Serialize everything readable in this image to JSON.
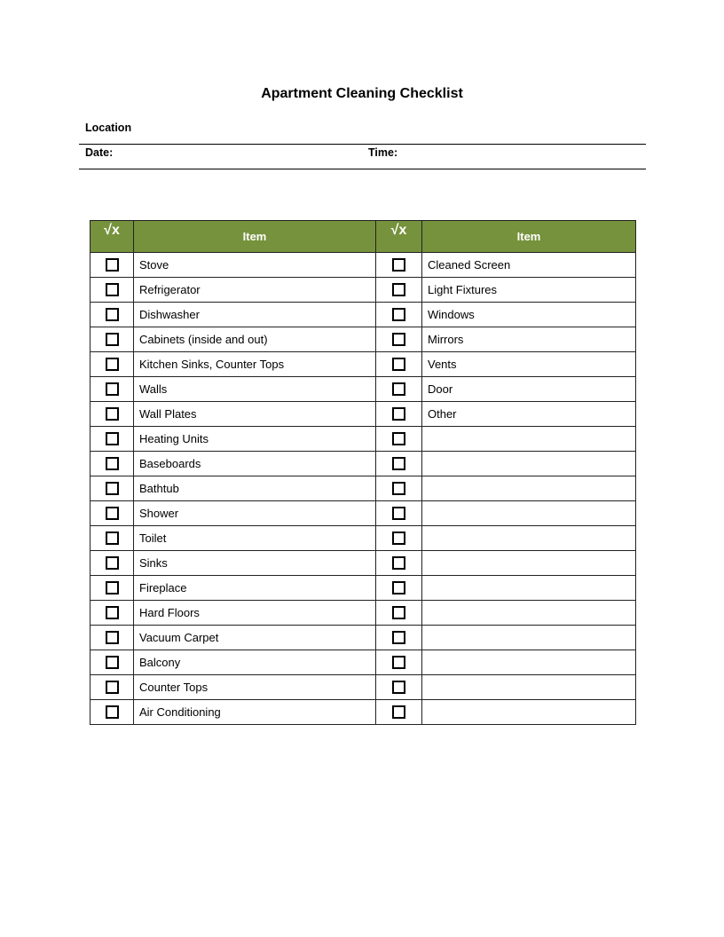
{
  "document": {
    "title": "Apartment Cleaning Checklist",
    "location_label": "Location",
    "date_label": "Date:",
    "time_label": "Time:"
  },
  "table": {
    "check_header": "√x",
    "item_header": "Item",
    "left_items": [
      "Stove",
      "Refrigerator",
      "Dishwasher",
      "Cabinets  (inside and out)",
      "Kitchen Sinks, Counter Tops",
      "Walls",
      "Wall Plates",
      "Heating Units",
      "Baseboards",
      "Bathtub",
      "Shower",
      "Toilet",
      "Sinks",
      "Fireplace",
      "Hard Floors",
      "Vacuum Carpet",
      "Balcony",
      "Counter Tops",
      "Air Conditioning"
    ],
    "right_items": [
      "Cleaned Screen",
      "Light Fixtures",
      "Windows",
      "Mirrors",
      "Vents",
      "Door",
      "Other",
      "",
      "",
      "",
      "",
      "",
      "",
      "",
      "",
      "",
      "",
      "",
      ""
    ]
  }
}
